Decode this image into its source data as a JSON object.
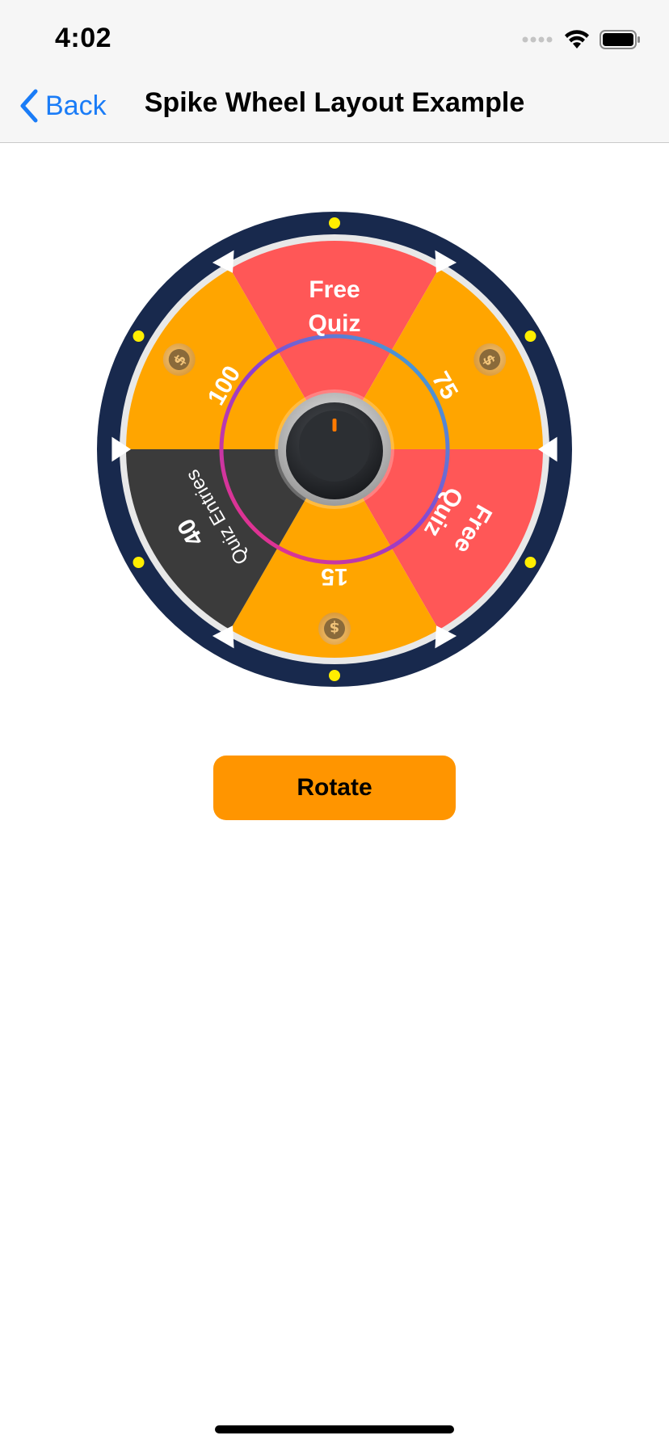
{
  "status_bar": {
    "time": "4:02"
  },
  "nav": {
    "back_label": "Back",
    "title": "Spike Wheel Layout Example"
  },
  "wheel": {
    "segments": [
      {
        "title": "Free",
        "subtitle": "Quiz",
        "color": "#ff5757"
      },
      {
        "title": "75",
        "coin": true,
        "color": "#ffa500"
      },
      {
        "title": "Free",
        "subtitle": "Quiz",
        "color": "#ff5757"
      },
      {
        "title": "15",
        "coin": true,
        "color": "#ffa500"
      },
      {
        "title": "40",
        "subtitle": "Quiz Entries",
        "color": "#3b3b3b"
      },
      {
        "title": "100",
        "coin": true,
        "color": "#ffa500"
      }
    ],
    "colors": {
      "rim": "#18294d",
      "dots": "#ffee00",
      "inner_ring_gradient": [
        "#2fb6d6",
        "#8e3fd1",
        "#ff2e7a"
      ]
    }
  },
  "rotate_button": {
    "label": "Rotate",
    "color": "#ff9500"
  },
  "icons": {
    "back": "chevron-left-icon",
    "signal": "cellular-signal-icon",
    "wifi": "wifi-icon",
    "battery": "battery-icon",
    "coin": "coin-icon",
    "knob": "knob-icon"
  }
}
